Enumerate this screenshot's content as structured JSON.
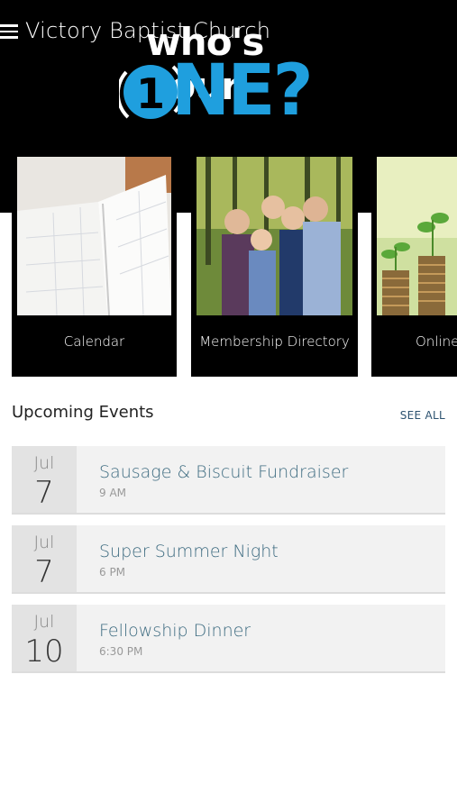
{
  "header": {
    "title": "Victory Baptist Church",
    "logo_text_top": "who's your",
    "logo_number": "1",
    "logo_text_bottom": "NE?",
    "accent_color": "#1f9fde"
  },
  "cards": [
    {
      "label": "Calendar",
      "image": "calendar-photo"
    },
    {
      "label": "Membership Directory",
      "image": "family-photo"
    },
    {
      "label": "Online",
      "image": "coins-plants-photo"
    }
  ],
  "events_section": {
    "title": "Upcoming Events",
    "see_all_label": "SEE ALL",
    "events": [
      {
        "month": "Jul",
        "day": "7",
        "name": "Sausage & Biscuit Fundraiser",
        "time": "9 AM"
      },
      {
        "month": "Jul",
        "day": "7",
        "name": "Super Summer Night",
        "time": "6 PM"
      },
      {
        "month": "Jul",
        "day": "10",
        "name": "Fellowship Dinner",
        "time": "6:30 PM"
      }
    ]
  }
}
